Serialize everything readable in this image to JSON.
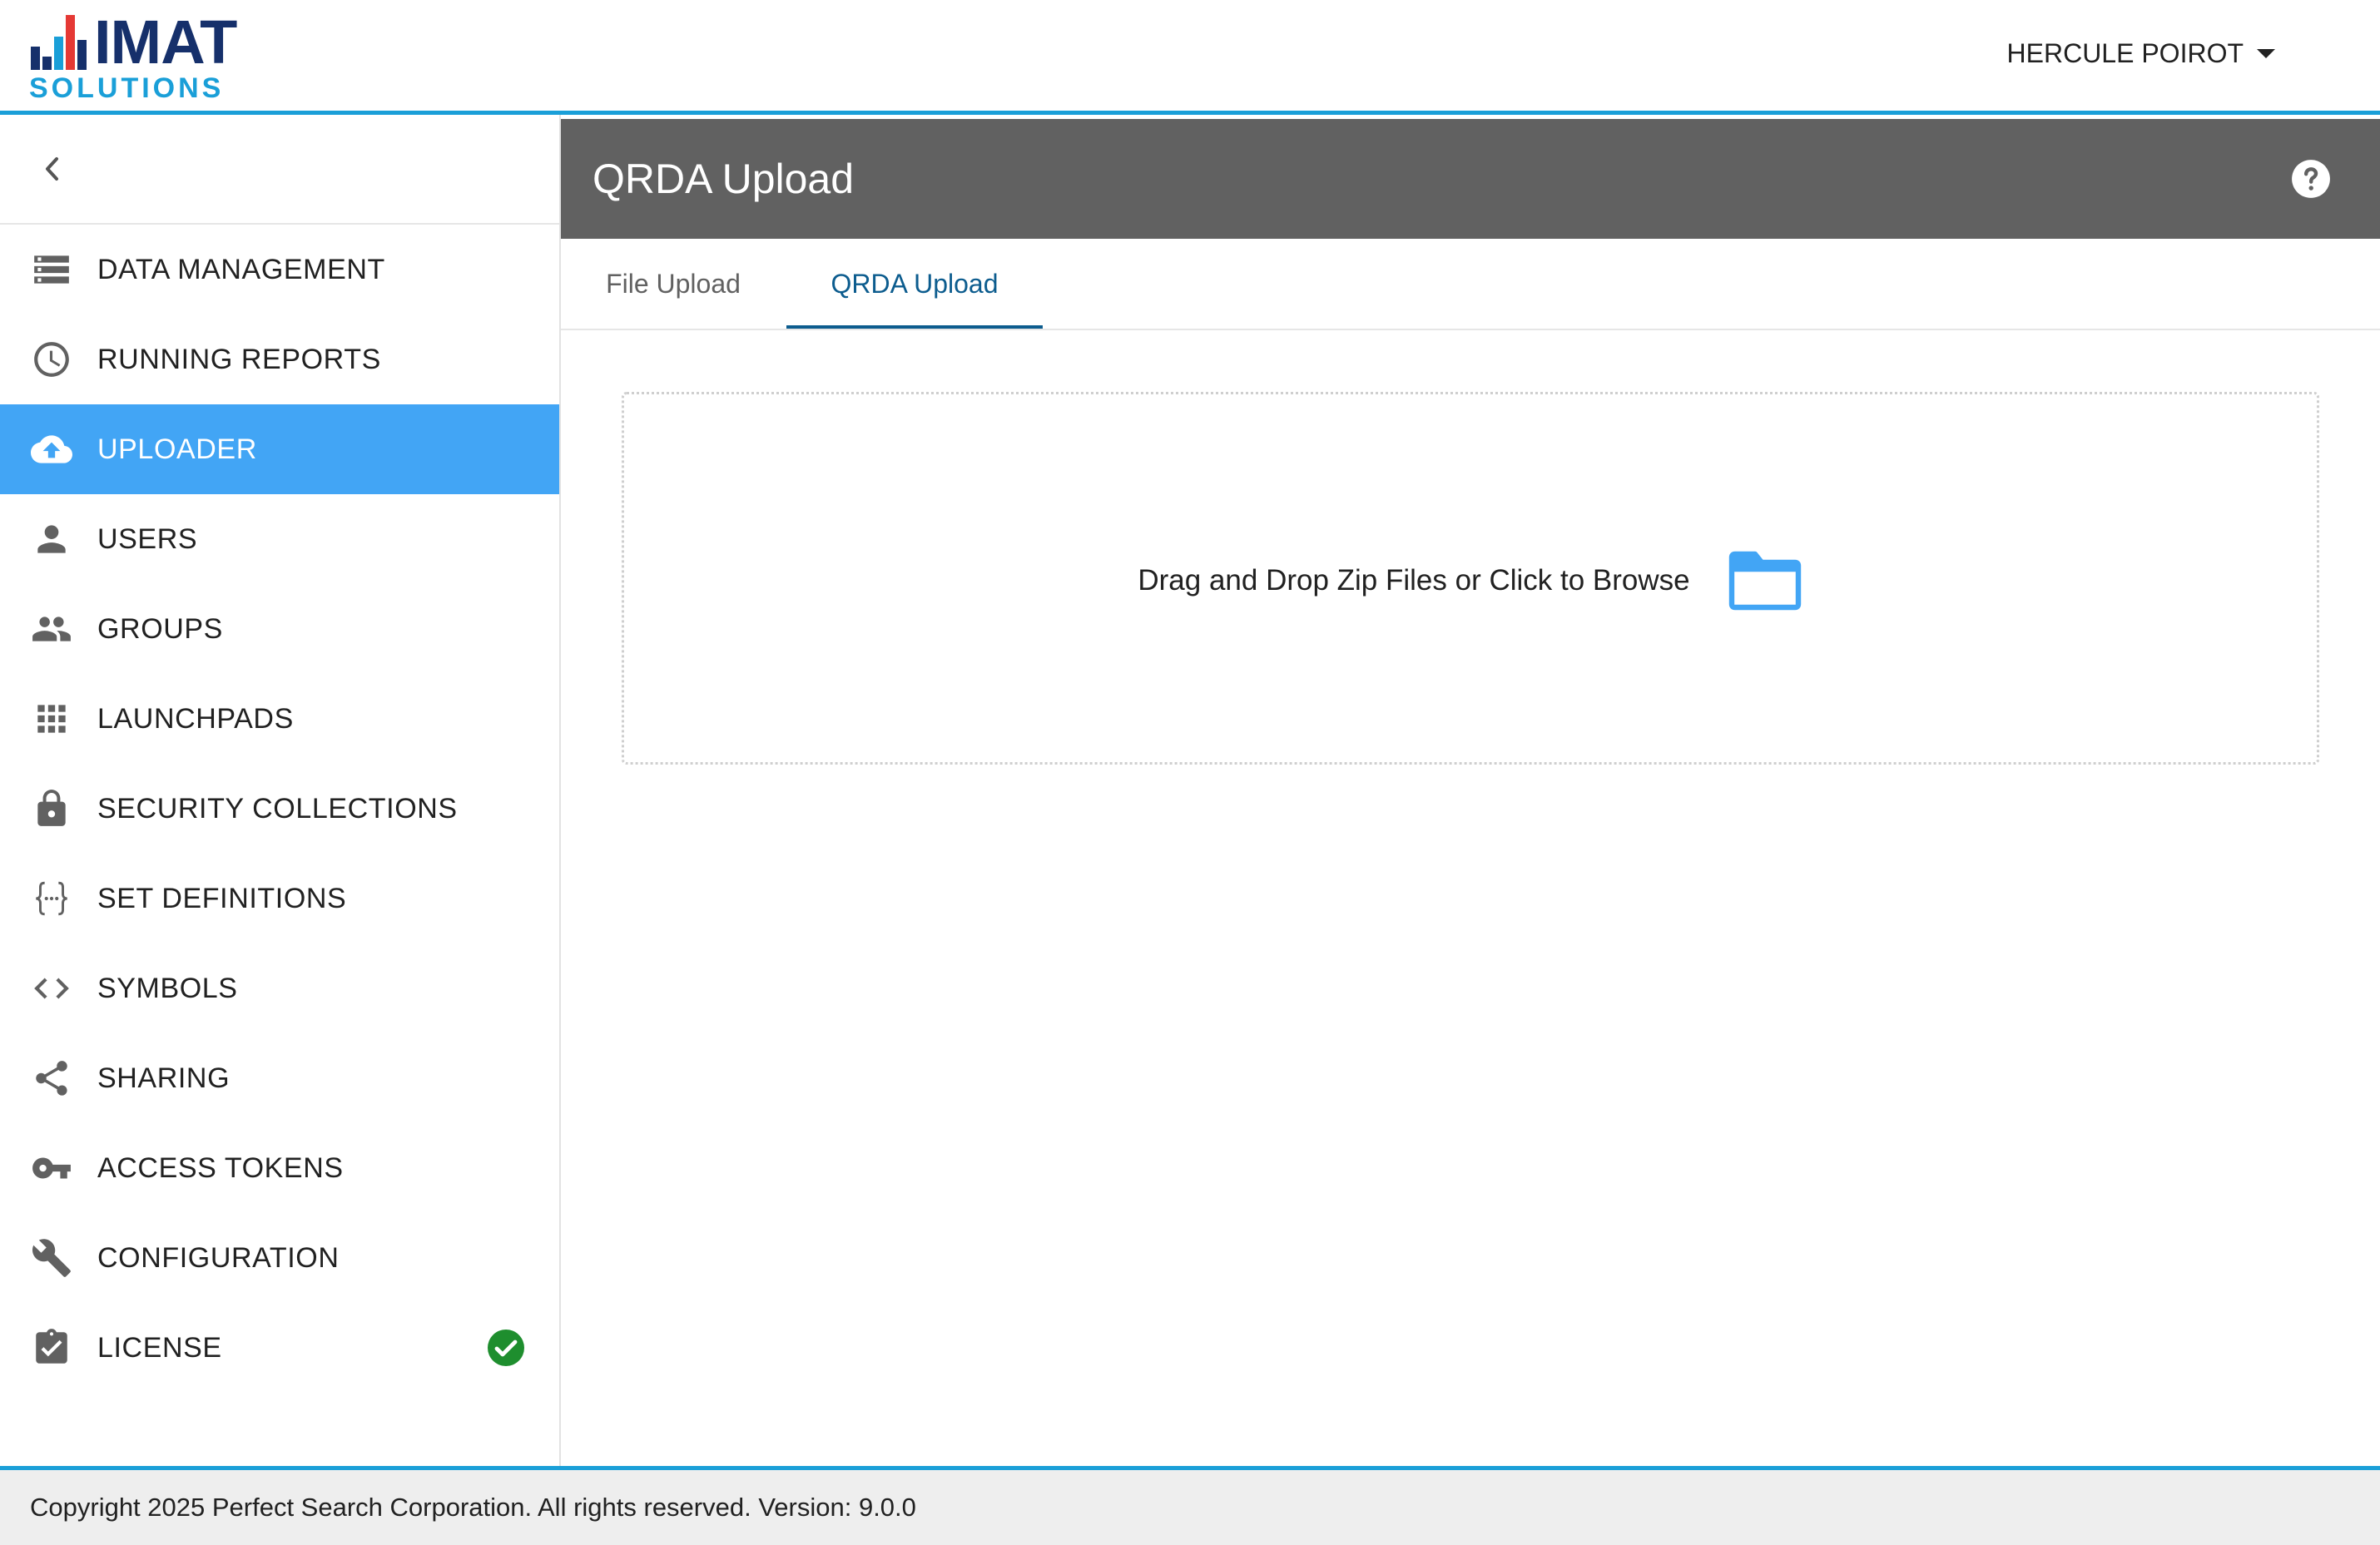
{
  "header": {
    "logo_text": "IMAT",
    "logo_subtext": "SOLUTIONS",
    "user_name": "HERCULE POIROT",
    "user_menu_icon": "caret-down-icon"
  },
  "colors": {
    "accent": "#1a9fd8",
    "active_nav": "#42a5f5",
    "title_bar": "#616161",
    "tab_active": "#0c5c8e",
    "folder": "#42a5f5",
    "license_ok": "#1e8e2e"
  },
  "sidebar": {
    "collapse_icon": "chevron-left-icon",
    "items": [
      {
        "label": "DATA MANAGEMENT",
        "icon": "storage-icon"
      },
      {
        "label": "RUNNING REPORTS",
        "icon": "clock-icon"
      },
      {
        "label": "UPLOADER",
        "icon": "cloud-upload-icon",
        "active": true
      },
      {
        "label": "USERS",
        "icon": "person-icon"
      },
      {
        "label": "GROUPS",
        "icon": "people-icon"
      },
      {
        "label": "LAUNCHPADS",
        "icon": "grid-icon"
      },
      {
        "label": "SECURITY COLLECTIONS",
        "icon": "lock-icon"
      },
      {
        "label": "SET DEFINITIONS",
        "icon": "braces-icon"
      },
      {
        "label": "SYMBOLS",
        "icon": "code-icon"
      },
      {
        "label": "SHARING",
        "icon": "share-icon"
      },
      {
        "label": "ACCESS TOKENS",
        "icon": "key-icon"
      },
      {
        "label": "CONFIGURATION",
        "icon": "wrench-icon"
      },
      {
        "label": "LICENSE",
        "icon": "clipboard-check-icon",
        "status_icon": "check-circle-icon"
      }
    ]
  },
  "page": {
    "title": "QRDA Upload",
    "help_icon": "help-circle-icon",
    "tabs": [
      {
        "label": "File Upload",
        "active": false
      },
      {
        "label": "QRDA Upload",
        "active": true
      }
    ],
    "dropzone": {
      "text": "Drag and Drop Zip Files or Click to Browse",
      "icon": "folder-icon"
    }
  },
  "footer": {
    "text": "Copyright 2025 Perfect Search Corporation. All rights reserved. Version: 9.0.0"
  }
}
